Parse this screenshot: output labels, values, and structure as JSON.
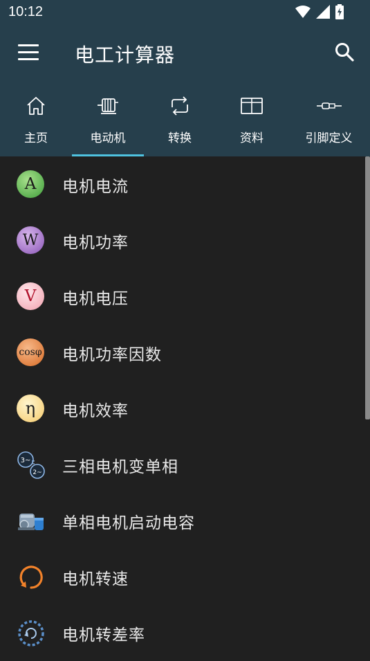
{
  "status": {
    "time": "10:12"
  },
  "app": {
    "title": "电工计算器"
  },
  "tabs": [
    {
      "label": "主页",
      "icon": "home-icon"
    },
    {
      "label": "电动机",
      "icon": "motor-icon",
      "selected": true
    },
    {
      "label": "转换",
      "icon": "repeat-icon"
    },
    {
      "label": "资料",
      "icon": "book-icon"
    },
    {
      "label": "引脚定义",
      "icon": "connector-icon"
    }
  ],
  "items": [
    {
      "label": "电机电流",
      "badge": "A"
    },
    {
      "label": "电机功率",
      "badge": "W"
    },
    {
      "label": "电机电压",
      "badge": "V"
    },
    {
      "label": "电机功率因数",
      "badge": "cosφ"
    },
    {
      "label": "电机效率",
      "badge": "η"
    },
    {
      "label": "三相电机变单相",
      "badge": "3~ 2~",
      "badge_top": "3~",
      "badge_bottom": "2~"
    },
    {
      "label": "单相电机启动电容",
      "badge": ""
    },
    {
      "label": "电机转速",
      "badge": ""
    },
    {
      "label": "电机转差率",
      "badge": ""
    }
  ],
  "colors": {
    "appbar": "#263f4c",
    "background": "#202020",
    "indicator": "#4fc3e0"
  }
}
